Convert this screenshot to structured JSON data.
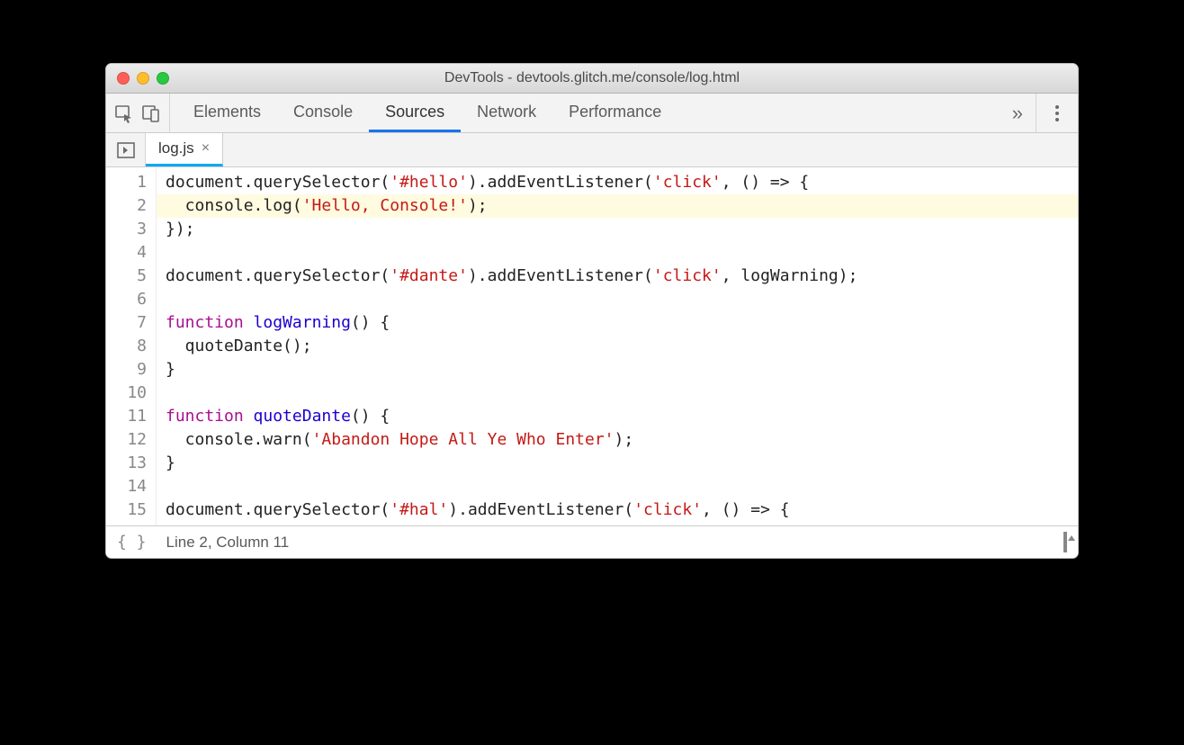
{
  "window": {
    "title": "DevTools - devtools.glitch.me/console/log.html"
  },
  "tabs": {
    "items": [
      "Elements",
      "Console",
      "Sources",
      "Network",
      "Performance"
    ],
    "active_index": 2,
    "overflow_glyph": "»"
  },
  "file": {
    "name": "log.js",
    "close_glyph": "×"
  },
  "code": {
    "highlighted_line": 2,
    "lines": [
      [
        {
          "t": "document.querySelector(",
          "c": ""
        },
        {
          "t": "'#hello'",
          "c": "tok-str"
        },
        {
          "t": ").addEventListener(",
          "c": ""
        },
        {
          "t": "'click'",
          "c": "tok-str"
        },
        {
          "t": ", () => {",
          "c": ""
        }
      ],
      [
        {
          "t": "  console.log(",
          "c": ""
        },
        {
          "t": "'Hello, Console!'",
          "c": "tok-str"
        },
        {
          "t": ");",
          "c": ""
        }
      ],
      [
        {
          "t": "});",
          "c": ""
        }
      ],
      [],
      [
        {
          "t": "document.querySelector(",
          "c": ""
        },
        {
          "t": "'#dante'",
          "c": "tok-str"
        },
        {
          "t": ").addEventListener(",
          "c": ""
        },
        {
          "t": "'click'",
          "c": "tok-str"
        },
        {
          "t": ", logWarning);",
          "c": ""
        }
      ],
      [],
      [
        {
          "t": "function",
          "c": "tok-kw"
        },
        {
          "t": " ",
          "c": ""
        },
        {
          "t": "logWarning",
          "c": "tok-fn"
        },
        {
          "t": "() {",
          "c": ""
        }
      ],
      [
        {
          "t": "  quoteDante();",
          "c": ""
        }
      ],
      [
        {
          "t": "}",
          "c": ""
        }
      ],
      [],
      [
        {
          "t": "function",
          "c": "tok-kw"
        },
        {
          "t": " ",
          "c": ""
        },
        {
          "t": "quoteDante",
          "c": "tok-fn"
        },
        {
          "t": "() {",
          "c": ""
        }
      ],
      [
        {
          "t": "  console.warn(",
          "c": ""
        },
        {
          "t": "'Abandon Hope All Ye Who Enter'",
          "c": "tok-str"
        },
        {
          "t": ");",
          "c": ""
        }
      ],
      [
        {
          "t": "}",
          "c": ""
        }
      ],
      [],
      [
        {
          "t": "document.querySelector(",
          "c": ""
        },
        {
          "t": "'#hal'",
          "c": "tok-str"
        },
        {
          "t": ").addEventListener(",
          "c": ""
        },
        {
          "t": "'click'",
          "c": "tok-str"
        },
        {
          "t": ", () => {",
          "c": ""
        }
      ]
    ]
  },
  "status": {
    "brackets_glyph": "{ }",
    "cursor_text": "Line 2, Column 11"
  }
}
